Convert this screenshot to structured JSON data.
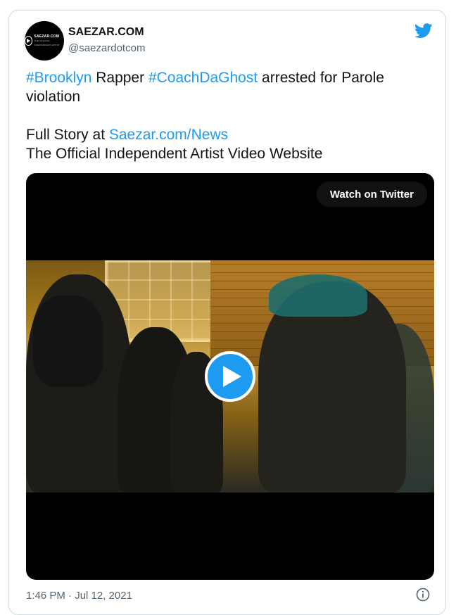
{
  "author": {
    "display_name": "SAEZAR.COM",
    "handle": "@saezardotcom",
    "avatar_text": "SAEZAR.COM",
    "avatar_subtext": "THE OFFICIAL INDEPENDENT ARTIST"
  },
  "tweet": {
    "line1": {
      "hashtag1": "#Brooklyn",
      "text1": " Rapper ",
      "hashtag2": "#CoachDaGhost",
      "text2": " arrested for Parole violation"
    },
    "line2": {
      "text": "Full Story at ",
      "link": "Saezar.com/News"
    },
    "line3": "The Official Independent Artist Video Website"
  },
  "media": {
    "watch_label": "Watch on Twitter",
    "play_icon": "play-icon"
  },
  "footer": {
    "timestamp": "1:46 PM · Jul 12, 2021",
    "info_icon": "info-icon"
  },
  "colors": {
    "link": "#1d9bf0",
    "twitter_blue": "#1d9bf0",
    "text": "#0f1419",
    "muted": "#536471"
  }
}
